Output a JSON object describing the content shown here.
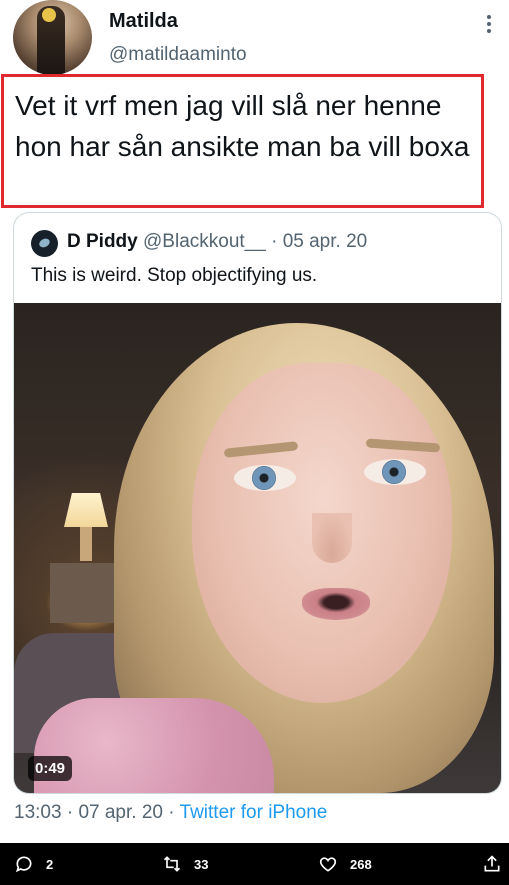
{
  "tweet": {
    "author": {
      "name": "Matilda",
      "handle": "@matildaaminto"
    },
    "text": "Vet it vrf men jag vill slå ner henne hon har sån ansikte man ba vill boxa",
    "highlight_color": "#e0282e",
    "quoted": {
      "name": "D Piddy",
      "handle": "@Blackkout__",
      "separator": "·",
      "date": "05 apr. 20",
      "text": "This is weird. Stop objectifying us.",
      "video": {
        "duration": "0:49"
      }
    },
    "timestamp": {
      "time": "13:03",
      "date": "07 apr. 20",
      "separator": "·",
      "client": "Twitter for iPhone"
    }
  },
  "actions": {
    "reply": {
      "icon": "reply-icon",
      "count": "2"
    },
    "retweet": {
      "icon": "retweet-icon",
      "count": "33"
    },
    "like": {
      "icon": "heart-icon",
      "count": "268"
    },
    "share": {
      "icon": "share-icon"
    }
  },
  "colors": {
    "link": "#1d9bf0",
    "muted": "#536471",
    "text": "#0f1419",
    "bar": "#000000"
  }
}
